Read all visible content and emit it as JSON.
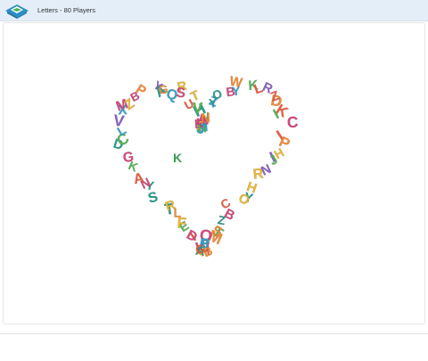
{
  "app": {
    "title": "Letters - 80 Players",
    "logo_icon": "paper-airplane-box-icon"
  },
  "colors": {
    "titlebar": "#e3eef8",
    "letter_palette": [
      "#e8b73a",
      "#3aa3c9",
      "#e85f43",
      "#5ab55a",
      "#d24b7f",
      "#f08c3a",
      "#8a63c2",
      "#2e9b8f"
    ]
  },
  "board": {
    "shape": "heart",
    "player_count": 80,
    "letters": "MASUHIYZOBYWKLRDZKICIPHIJNRHYOCBZTSMOWIBZBAGPIDEFLTRSYNAKGDCLVXMZBPYAGQRSTUVNEHJK",
    "stray_letter": "K"
  }
}
